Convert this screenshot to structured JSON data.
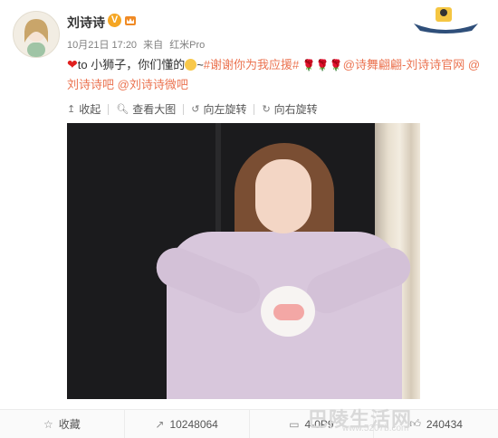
{
  "user": {
    "name": "刘诗诗",
    "badge": "V"
  },
  "meta": {
    "time": "10月21日 17:20",
    "source_prefix": "来自",
    "device": "红米Pro"
  },
  "post": {
    "text_1": "to 小狮子，你们懂的",
    "text_2": "~",
    "hashtag": "#谢谢你为我应援#",
    "mention_1": "@诗舞翩翩-刘诗诗官网",
    "mention_2": "@刘诗诗吧",
    "mention_3": "@刘诗诗微吧"
  },
  "toolbar": {
    "collapse": "收起",
    "view_large": "查看大图",
    "rotate_left": "向左旋转",
    "rotate_right": "向右旋转"
  },
  "actions": {
    "favorite": "收藏",
    "repost_count": "10248064",
    "comment_count": "4-0P9",
    "like_count": "240434"
  },
  "watermark": {
    "text": "巴陵生活网",
    "url": "www.5207b.com"
  },
  "colors": {
    "link": "#eb7350",
    "badge": "#f5a623"
  }
}
